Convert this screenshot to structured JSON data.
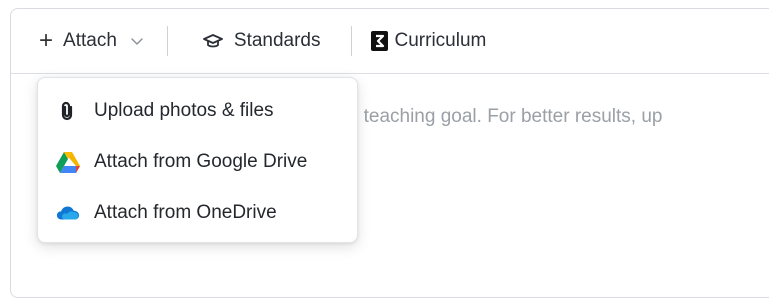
{
  "toolbar": {
    "attach_label": "Attach",
    "standards_label": "Standards",
    "curriculum_label": "Curriculum"
  },
  "prompt": {
    "placeholder": "r teaching goal. For better results, up"
  },
  "attach_menu": {
    "items": [
      {
        "label": "Upload photos & files",
        "icon": "paperclip-icon"
      },
      {
        "label": "Attach from Google Drive",
        "icon": "google-drive-icon"
      },
      {
        "label": "Attach from OneDrive",
        "icon": "onedrive-icon"
      }
    ]
  },
  "colors": {
    "text": "#2b2f36",
    "placeholder": "#9aa0a6",
    "border": "#d9dbe0",
    "drive_green": "#0f9d58",
    "drive_yellow": "#f4b400",
    "drive_blue": "#4285f4",
    "onedrive_blue": "#0f78d4"
  }
}
